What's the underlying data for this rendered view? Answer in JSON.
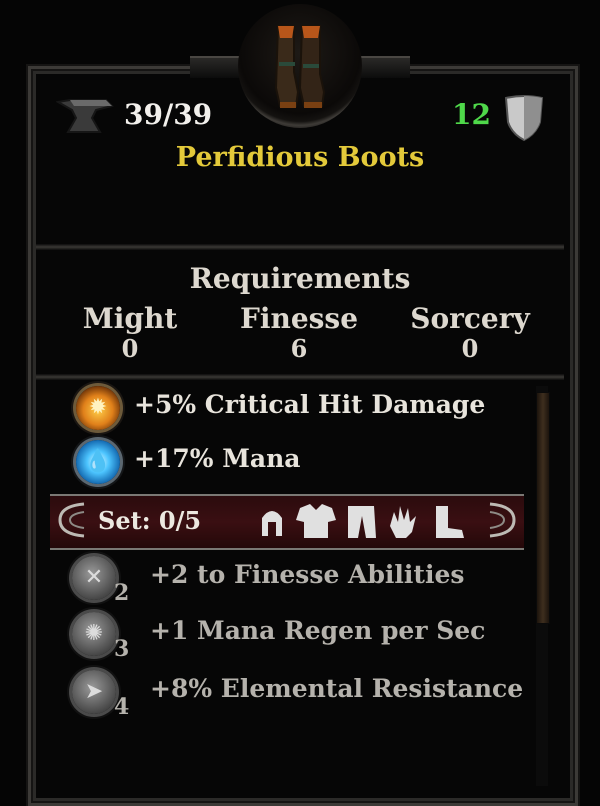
{
  "item": {
    "name": "Perfidious Boots",
    "icon": "boots-icon",
    "durability": "39/39",
    "armor": "12",
    "colors": {
      "name": "#e3c93a",
      "armor": "#4fd84a"
    }
  },
  "requirements": {
    "title": "Requirements",
    "stats": [
      {
        "label": "Might",
        "value": "0"
      },
      {
        "label": "Finesse",
        "value": "6"
      },
      {
        "label": "Sorcery",
        "value": "0"
      }
    ]
  },
  "bonuses": [
    {
      "icon": "critical-hit-orb-icon",
      "amount": "+5",
      "text": "% Critical Hit Damage"
    },
    {
      "icon": "mana-orb-icon",
      "amount": "+17",
      "text": "% Mana"
    }
  ],
  "set": {
    "label": "Set: 0/5",
    "pieces": [
      "helmet-icon",
      "chest-armor-icon",
      "pants-icon",
      "gloves-icon",
      "boots-piece-icon"
    ],
    "bonuses": [
      {
        "tier": "2",
        "icon": "finesse-orb-icon",
        "text": "+2 to Finesse Abilities"
      },
      {
        "tier": "3",
        "icon": "regen-orb-icon",
        "text": "+1 Mana Regen per Sec"
      },
      {
        "tier": "4",
        "icon": "elemental-orb-icon",
        "text": "+8% Elemental Resistance"
      }
    ]
  }
}
